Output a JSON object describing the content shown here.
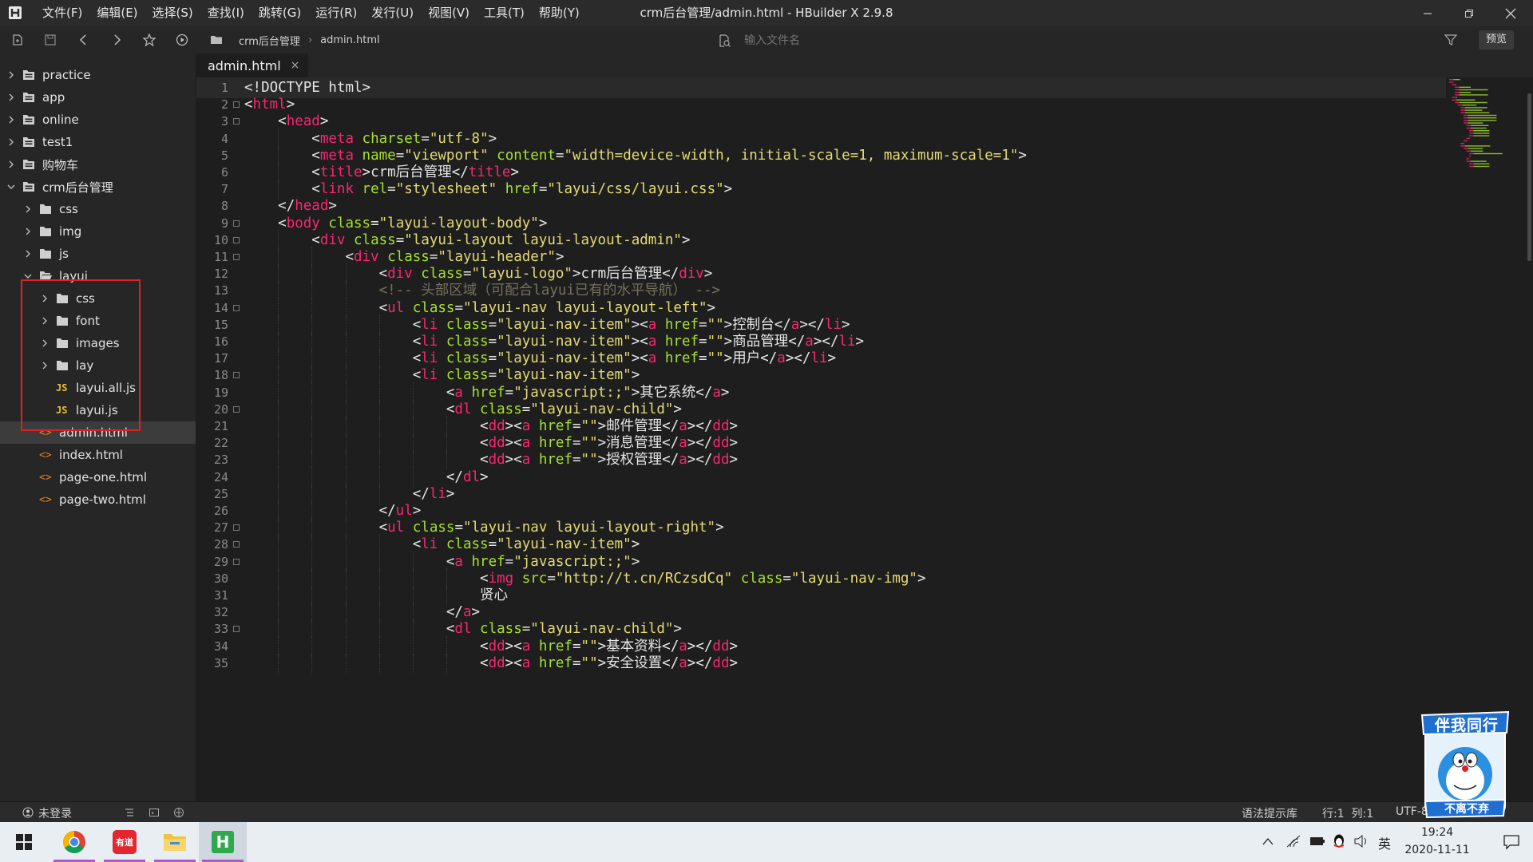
{
  "app": {
    "window_title": "crm后台管理/admin.html - HBuilder X 2.9.8",
    "menu": [
      "文件(F)",
      "编辑(E)",
      "选择(S)",
      "查找(I)",
      "跳转(G)",
      "运行(R)",
      "发行(U)",
      "视图(V)",
      "工具(T)",
      "帮助(Y)"
    ]
  },
  "toolbar": {
    "breadcrumb": [
      "crm后台管理",
      "admin.html"
    ],
    "search_placeholder": "输入文件名",
    "preview_label": "预览"
  },
  "sidebar": {
    "items": [
      {
        "label": "practice",
        "type": "project"
      },
      {
        "label": "app",
        "type": "project"
      },
      {
        "label": "online",
        "type": "project"
      },
      {
        "label": "test1",
        "type": "project"
      },
      {
        "label": "购物车",
        "type": "project"
      },
      {
        "label": "crm后台管理",
        "type": "project"
      },
      {
        "label": "css",
        "type": "folder"
      },
      {
        "label": "img",
        "type": "folder"
      },
      {
        "label": "js",
        "type": "folder"
      },
      {
        "label": "layui",
        "type": "folder"
      },
      {
        "label": "css",
        "type": "folder"
      },
      {
        "label": "font",
        "type": "folder"
      },
      {
        "label": "images",
        "type": "folder"
      },
      {
        "label": "lay",
        "type": "folder"
      },
      {
        "label": "layui.all.js",
        "type": "js"
      },
      {
        "label": "layui.js",
        "type": "js"
      },
      {
        "label": "admin.html",
        "type": "html"
      },
      {
        "label": "index.html",
        "type": "html"
      },
      {
        "label": "page-one.html",
        "type": "html"
      },
      {
        "label": "page-two.html",
        "type": "html"
      }
    ]
  },
  "editor": {
    "tab_label": "admin.html",
    "tab_close": "×",
    "line_numbers": [
      "1",
      "2",
      "3",
      "4",
      "5",
      "6",
      "7",
      "8",
      "9",
      "10",
      "11",
      "12",
      "13",
      "14",
      "15",
      "16",
      "17",
      "18",
      "19",
      "20",
      "21",
      "22",
      "23",
      "24",
      "25",
      "26",
      "27",
      "28",
      "29",
      "30",
      "31",
      "32",
      "33",
      "34",
      "35"
    ],
    "lines": [
      "<!DOCTYPE html>",
      "<html>",
      "    <head>",
      "        <meta charset=\"utf-8\">",
      "        <meta name=\"viewport\" content=\"width=device-width, initial-scale=1, maximum-scale=1\">",
      "        <title>crm后台管理</title>",
      "        <link rel=\"stylesheet\" href=\"layui/css/layui.css\">",
      "    </head>",
      "    <body class=\"layui-layout-body\">",
      "        <div class=\"layui-layout layui-layout-admin\">",
      "            <div class=\"layui-header\">",
      "                <div class=\"layui-logo\">crm后台管理</div>",
      "                <!-- 头部区域（可配合layui已有的水平导航） -->",
      "                <ul class=\"layui-nav layui-layout-left\">",
      "                    <li class=\"layui-nav-item\"><a href=\"\">控制台</a></li>",
      "                    <li class=\"layui-nav-item\"><a href=\"\">商品管理</a></li>",
      "                    <li class=\"layui-nav-item\"><a href=\"\">用户</a></li>",
      "                    <li class=\"layui-nav-item\">",
      "                        <a href=\"javascript:;\">其它系统</a>",
      "                        <dl class=\"layui-nav-child\">",
      "                            <dd><a href=\"\">邮件管理</a></dd>",
      "                            <dd><a href=\"\">消息管理</a></dd>",
      "                            <dd><a href=\"\">授权管理</a></dd>",
      "                        </dl>",
      "                    </li>",
      "                </ul>",
      "                <ul class=\"layui-nav layui-layout-right\">",
      "                    <li class=\"layui-nav-item\">",
      "                        <a href=\"javascript:;\">",
      "                            <img src=\"http://t.cn/RCzsdCq\" class=\"layui-nav-img\">",
      "                            贤心",
      "                        </a>",
      "                        <dl class=\"layui-nav-child\">",
      "                            <dd><a href=\"\">基本资料</a></dd>",
      "                            <dd><a href=\"\">安全设置</a></dd>"
    ]
  },
  "statusbar": {
    "login": "未登录",
    "syntax_lib": "语法提示库",
    "cursor": "行:1  列:1",
    "encoding": "UTF-8"
  },
  "taskbar": {
    "time": "19:24",
    "date": "2020-11-11",
    "ime": "英"
  },
  "sticker": {
    "top_text": "伴我同行",
    "bottom_text": "不离不弃"
  },
  "colors": {
    "tag": "#f92672",
    "attr": "#a6e22e",
    "string": "#e6db74",
    "comment": "#75715e",
    "highlight_box": "#e02020"
  }
}
